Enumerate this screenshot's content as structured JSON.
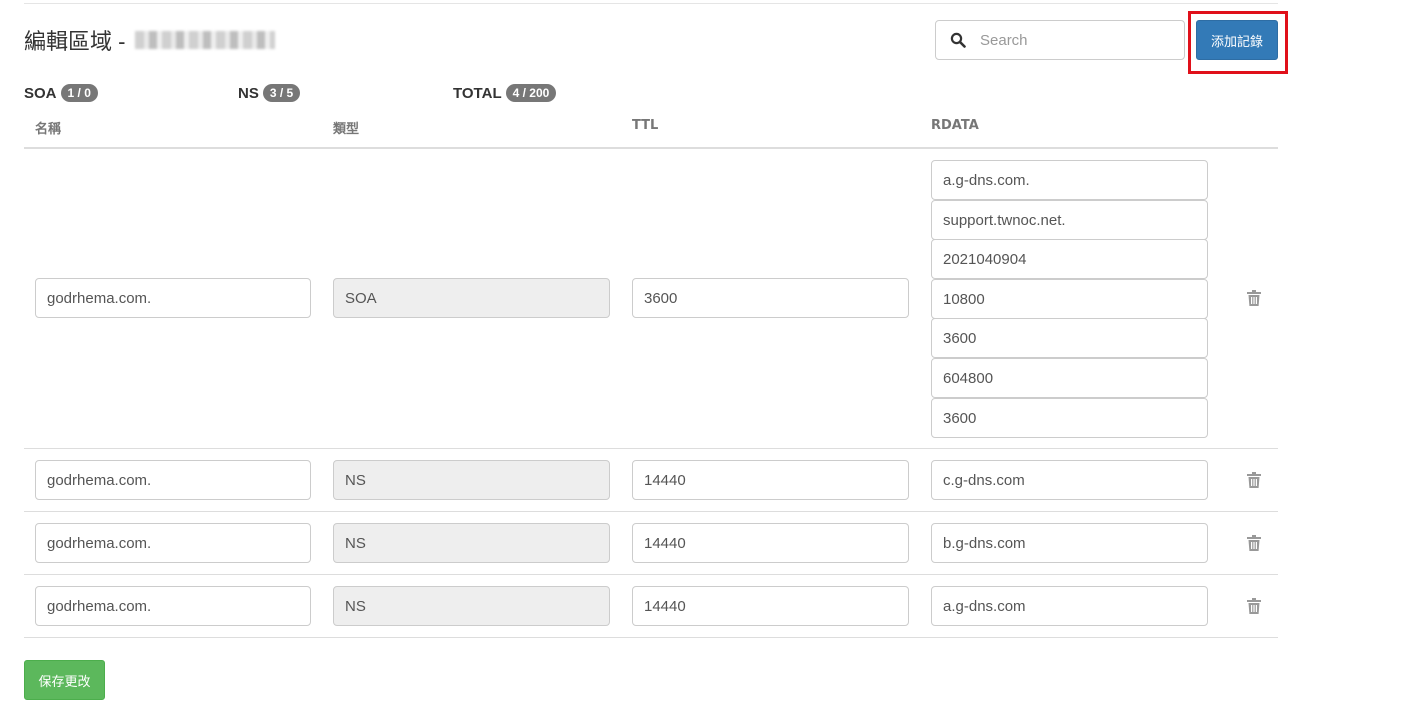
{
  "header": {
    "title": "編輯區域 -"
  },
  "search": {
    "placeholder": "Search",
    "value": ""
  },
  "toolbar": {
    "add_record_label": "添加記錄",
    "save_label": "保存更改"
  },
  "counters": [
    {
      "label": "SOA",
      "badge": "1 / 0"
    },
    {
      "label": "NS",
      "badge": "3 / 5"
    },
    {
      "label": "TOTAL",
      "badge": "4 / 200"
    }
  ],
  "columns": {
    "name": "名稱",
    "type": "類型",
    "ttl": "TTL",
    "rdata": "RDATA"
  },
  "records": [
    {
      "name": "godrhema.com.",
      "type": "SOA",
      "ttl": "3600",
      "rdata": [
        "a.g-dns.com.",
        "support.twnoc.net.",
        "2021040904",
        "10800",
        "3600",
        "604800",
        "3600"
      ]
    },
    {
      "name": "godrhema.com.",
      "type": "NS",
      "ttl": "14440",
      "rdata": [
        "c.g-dns.com"
      ]
    },
    {
      "name": "godrhema.com.",
      "type": "NS",
      "ttl": "14440",
      "rdata": [
        "b.g-dns.com"
      ]
    },
    {
      "name": "godrhema.com.",
      "type": "NS",
      "ttl": "14440",
      "rdata": [
        "a.g-dns.com"
      ]
    }
  ],
  "icons": {
    "search": "search-icon",
    "delete": "trash-icon"
  },
  "colors": {
    "primary": "#337ab7",
    "success": "#5cb85c",
    "highlight": "#e0101a",
    "badge": "#777777"
  }
}
